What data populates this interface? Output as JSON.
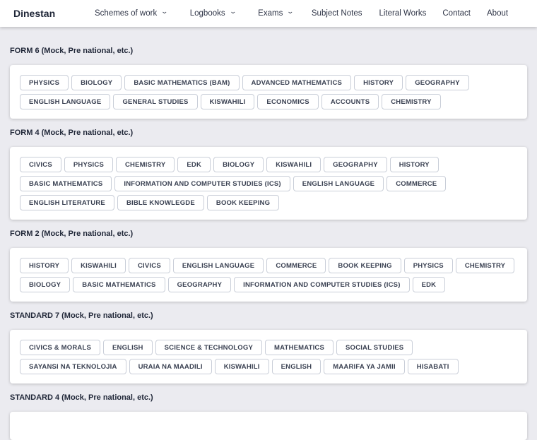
{
  "header": {
    "brand": "Dinestan",
    "nav": [
      {
        "label": "Schemes of work",
        "dropdown": true
      },
      {
        "label": "Logbooks",
        "dropdown": true
      },
      {
        "label": "Exams",
        "dropdown": true
      },
      {
        "label": "Subject Notes",
        "dropdown": false
      },
      {
        "label": "Literal Works",
        "dropdown": false
      },
      {
        "label": "Contact",
        "dropdown": false
      },
      {
        "label": "About",
        "dropdown": false
      }
    ]
  },
  "sections": [
    {
      "title": "FORM 6 (Mock, Pre national, etc.)",
      "subjects": [
        "PHYSICS",
        "BIOLOGY",
        "BASIC MATHEMATICS (BAM)",
        "ADVANCED MATHEMATICS",
        "HISTORY",
        "GEOGRAPHY",
        "ENGLISH LANGUAGE",
        "GENERAL STUDIES",
        "KISWAHILI",
        "ECONOMICS",
        "ACCOUNTS",
        "CHEMISTRY"
      ]
    },
    {
      "title": "FORM 4 (Mock, Pre national, etc.)",
      "subjects": [
        "CIVICS",
        "PHYSICS",
        "CHEMISTRY",
        "EDK",
        "BIOLOGY",
        "KISWAHILI",
        "GEOGRAPHY",
        "HISTORY",
        "BASIC MATHEMATICS",
        "INFORMATION AND COMPUTER STUDIES (ICS)",
        "ENGLISH LANGUAGE",
        "COMMERCE",
        "ENGLISH LITERATURE",
        "BIBLE KNOWLEGDE",
        "BOOK KEEPING"
      ]
    },
    {
      "title": "FORM 2 (Mock, Pre national, etc.)",
      "subjects": [
        "HISTORY",
        "KISWAHILI",
        "CIVICS",
        "ENGLISH LANGUAGE",
        "COMMERCE",
        "BOOK KEEPING",
        "PHYSICS",
        "CHEMISTRY",
        "BIOLOGY",
        "BASIC MATHEMATICS",
        "GEOGRAPHY",
        "INFORMATION AND COMPUTER STUDIES (ICS)",
        "EDK"
      ]
    },
    {
      "title": "STANDARD 7 (Mock, Pre national, etc.)",
      "subjects": [
        "CIVICS & MORALS",
        "ENGLISH",
        "SCIENCE & TECHNOLOGY",
        "MATHEMATICS",
        "SOCIAL STUDIES",
        "SAYANSI NA TEKNOLOJIA",
        "URAIA NA MAADILI",
        "KISWAHILI",
        "ENGLISH",
        "MAARIFA YA JAMII",
        "HISABATI"
      ]
    },
    {
      "title": "STANDARD 4 (Mock, Pre national, etc.)",
      "subjects": []
    }
  ]
}
